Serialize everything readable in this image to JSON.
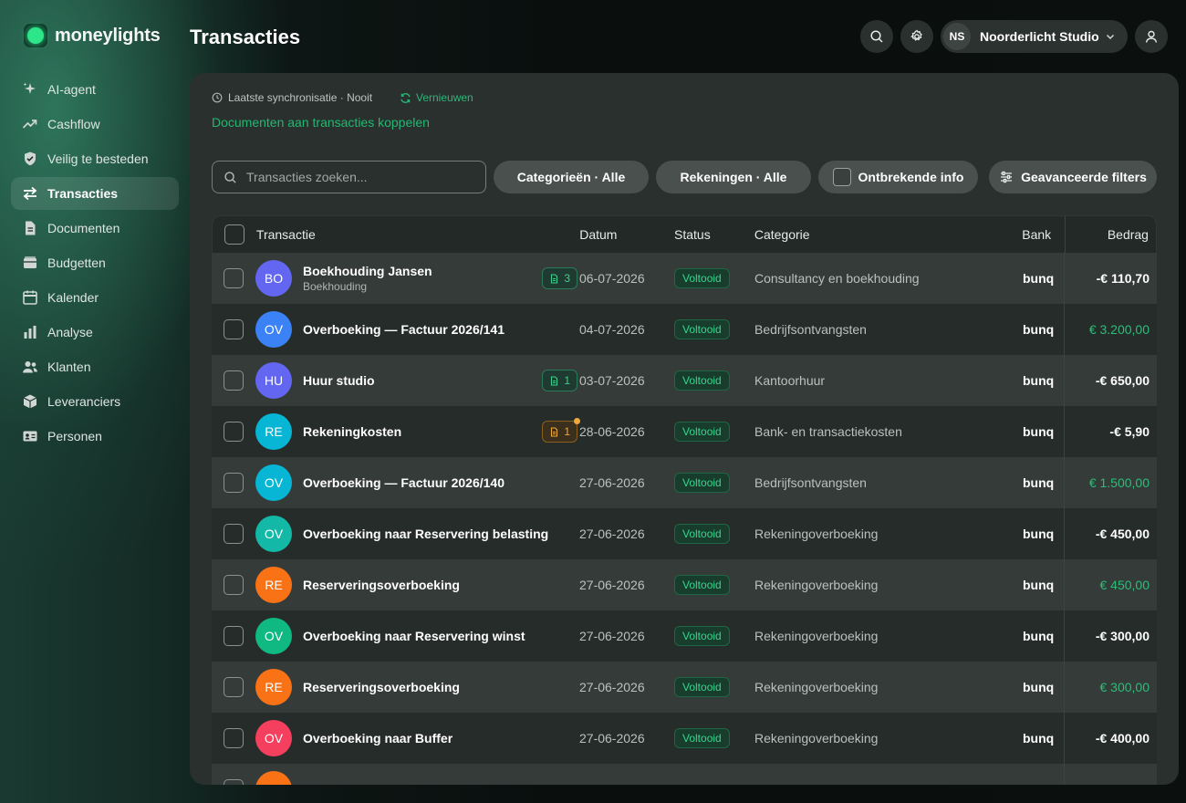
{
  "brand": {
    "name": "moneylights",
    "accent": "#2ee68a"
  },
  "nav": [
    {
      "label": "AI-agent",
      "icon": "sparkle-icon"
    },
    {
      "label": "Cashflow",
      "icon": "trend-up-icon"
    },
    {
      "label": "Veilig te besteden",
      "icon": "shield-check-icon"
    },
    {
      "label": "Transacties",
      "icon": "arrows-swap-icon",
      "active": true
    },
    {
      "label": "Documenten",
      "icon": "document-icon"
    },
    {
      "label": "Budgetten",
      "icon": "wallet-icon"
    },
    {
      "label": "Kalender",
      "icon": "calendar-icon"
    },
    {
      "label": "Analyse",
      "icon": "bar-chart-icon"
    },
    {
      "label": "Klanten",
      "icon": "users-icon"
    },
    {
      "label": "Leveranciers",
      "icon": "box-icon"
    },
    {
      "label": "Personen",
      "icon": "id-card-icon"
    }
  ],
  "header": {
    "title": "Transacties",
    "org": {
      "initials": "NS",
      "name": "Noorderlicht Studio"
    }
  },
  "sync": {
    "label": "Laatste synchronisatie · Nooit",
    "refresh": "Vernieuwen",
    "doc_link": "Documenten aan transacties koppelen"
  },
  "filters": {
    "search_placeholder": "Transacties zoeken...",
    "categories": "Categorieën · Alle",
    "accounts": "Rekeningen · Alle",
    "missing": "Ontbrekende info",
    "advanced": "Geavanceerde filters"
  },
  "table": {
    "headers": {
      "transaction": "Transactie",
      "date": "Datum",
      "status": "Status",
      "category": "Categorie",
      "bank": "Bank",
      "amount": "Bedrag"
    },
    "rows": [
      {
        "initials": "BO",
        "color": "#6366f1",
        "name": "Boekhouding Jansen",
        "sub": "Boekhouding",
        "docs": "3",
        "doc_warn": false,
        "date": "06-07-2026",
        "status": "Voltooid",
        "category": "Consultancy en boekhouding",
        "bank": "bunq",
        "amount": "-€ 110,70",
        "positive": false
      },
      {
        "initials": "OV",
        "color": "#3b82f6",
        "name": "Overboeking — Factuur 2026/141",
        "sub": "",
        "docs": "",
        "doc_warn": false,
        "date": "04-07-2026",
        "status": "Voltooid",
        "category": "Bedrijfsontvangsten",
        "bank": "bunq",
        "amount": "€ 3.200,00",
        "positive": true
      },
      {
        "initials": "HU",
        "color": "#6366f1",
        "name": "Huur studio",
        "sub": "",
        "docs": "1",
        "doc_warn": false,
        "date": "03-07-2026",
        "status": "Voltooid",
        "category": "Kantoorhuur",
        "bank": "bunq",
        "amount": "-€ 650,00",
        "positive": false
      },
      {
        "initials": "RE",
        "color": "#06b6d4",
        "name": "Rekeningkosten",
        "sub": "",
        "docs": "1",
        "doc_warn": true,
        "date": "28-06-2026",
        "status": "Voltooid",
        "category": "Bank- en transactiekosten",
        "bank": "bunq",
        "amount": "-€ 5,90",
        "positive": false
      },
      {
        "initials": "OV",
        "color": "#06b6d4",
        "name": "Overboeking — Factuur 2026/140",
        "sub": "",
        "docs": "",
        "doc_warn": false,
        "date": "27-06-2026",
        "status": "Voltooid",
        "category": "Bedrijfsontvangsten",
        "bank": "bunq",
        "amount": "€ 1.500,00",
        "positive": true
      },
      {
        "initials": "OV",
        "color": "#14b8a6",
        "name": "Overboeking naar Reservering belasting",
        "sub": "",
        "docs": "",
        "doc_warn": false,
        "date": "27-06-2026",
        "status": "Voltooid",
        "category": "Rekeningoverboeking",
        "bank": "bunq",
        "amount": "-€ 450,00",
        "positive": false
      },
      {
        "initials": "RE",
        "color": "#f97316",
        "name": "Reserveringsoverboeking",
        "sub": "",
        "docs": "",
        "doc_warn": false,
        "date": "27-06-2026",
        "status": "Voltooid",
        "category": "Rekeningoverboeking",
        "bank": "bunq",
        "amount": "€ 450,00",
        "positive": true
      },
      {
        "initials": "OV",
        "color": "#10b981",
        "name": "Overboeking naar Reservering winst",
        "sub": "",
        "docs": "",
        "doc_warn": false,
        "date": "27-06-2026",
        "status": "Voltooid",
        "category": "Rekeningoverboeking",
        "bank": "bunq",
        "amount": "-€ 300,00",
        "positive": false
      },
      {
        "initials": "RE",
        "color": "#f97316",
        "name": "Reserveringsoverboeking",
        "sub": "",
        "docs": "",
        "doc_warn": false,
        "date": "27-06-2026",
        "status": "Voltooid",
        "category": "Rekeningoverboeking",
        "bank": "bunq",
        "amount": "€ 300,00",
        "positive": true
      },
      {
        "initials": "OV",
        "color": "#f43f5e",
        "name": "Overboeking naar Buffer",
        "sub": "",
        "docs": "",
        "doc_warn": false,
        "date": "27-06-2026",
        "status": "Voltooid",
        "category": "Rekeningoverboeking",
        "bank": "bunq",
        "amount": "-€ 400,00",
        "positive": false
      },
      {
        "initials": "",
        "color": "#f97316",
        "name": "",
        "sub": "",
        "docs": "",
        "doc_warn": false,
        "date": "",
        "status": "",
        "category": "",
        "bank": "",
        "amount": "",
        "positive": false
      }
    ]
  }
}
